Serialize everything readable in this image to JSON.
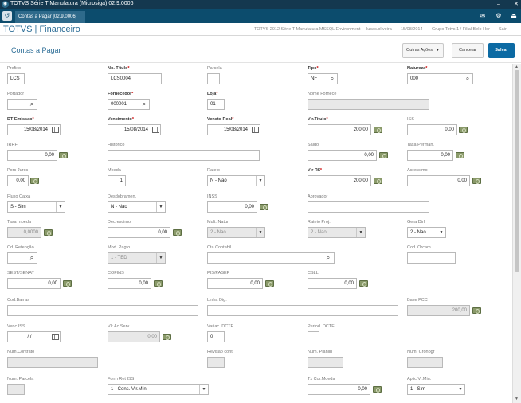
{
  "app": {
    "window_title": "TOTVS Série T Manufatura (Microsiga) 02.9.0006",
    "tab_label": "Contas a Pagar [02.9.0006]",
    "brand": "TOTVS | Financeiro",
    "env": "TOTVS 2012 Série T Manufatura MSSQL Environment",
    "user": "lucas.oliveira",
    "date": "15/08/2014",
    "company": "Grupo Totvs 1 / Filial Belo Hor",
    "logout": "Sair"
  },
  "page": {
    "title": "Contas a Pagar",
    "other_actions": "Outras Ações",
    "cancel": "Cancelar",
    "save": "Salvar"
  },
  "fields": {
    "prefixo": {
      "label": "Prefixo",
      "value": "LCS"
    },
    "no_titulo": {
      "label": "No. Título",
      "value": "LCS0004"
    },
    "parcela": {
      "label": "Parcela",
      "value": ""
    },
    "tipo": {
      "label": "Tipo",
      "value": "NF"
    },
    "natureza": {
      "label": "Natureza",
      "value": "000"
    },
    "portador": {
      "label": "Portador",
      "value": ""
    },
    "fornecedor": {
      "label": "Fornecedor",
      "value": "000001"
    },
    "loja": {
      "label": "Loja",
      "value": "01"
    },
    "nome_fornece": {
      "label": "Nome Fornece",
      "value": ""
    },
    "dt_emissao": {
      "label": "DT Emissao",
      "value": "15/08/2014"
    },
    "vencimento": {
      "label": "Vencimento",
      "value": "15/08/2014"
    },
    "vencto_real": {
      "label": "Vencto Real",
      "value": "15/08/2014"
    },
    "vlr_titulo": {
      "label": "Vlr.Titulo",
      "value": "200,00"
    },
    "iss": {
      "label": "ISS",
      "value": "0,00"
    },
    "irrf": {
      "label": "IRRF",
      "value": "0,00"
    },
    "historico": {
      "label": "Historico",
      "value": ""
    },
    "saldo": {
      "label": "Saldo",
      "value": "0,00"
    },
    "taxa_perman": {
      "label": "Taxa Perman.",
      "value": "0,00"
    },
    "porc_juros": {
      "label": "Porc Juros",
      "value": "0,00"
    },
    "moeda": {
      "label": "Moeda",
      "value": "1"
    },
    "rateio": {
      "label": "Rateio",
      "value": "N - Nao"
    },
    "vlr_rs": {
      "label": "Vlr R$",
      "value": "200,00"
    },
    "acrescimo": {
      "label": "Acrescimo",
      "value": "0,00"
    },
    "fluxo_caixa": {
      "label": "Fluxo Caixa",
      "value": "S - Sim"
    },
    "desdobramen": {
      "label": "Desdobramen.",
      "value": "N - Nao"
    },
    "inss": {
      "label": "INSS",
      "value": "0,00"
    },
    "aprovador": {
      "label": "Aprovador",
      "value": ""
    },
    "taxa_moeda": {
      "label": "Taxa moeda",
      "value": "0,0000"
    },
    "decrescimo": {
      "label": "Decrescimo",
      "value": "0,00"
    },
    "mult_natur": {
      "label": "Mult. Natur",
      "value": "2 - Nao"
    },
    "rateio_proj": {
      "label": "Rateio Proj.",
      "value": "2 - Nao"
    },
    "gera_dirf": {
      "label": "Gera Dirf",
      "value": "2 - Nao"
    },
    "cd_retencao": {
      "label": "Cd. Retenção",
      "value": ""
    },
    "mod_pagto": {
      "label": "Mod. Pagto.",
      "value": "1 - TED"
    },
    "cta_contabil": {
      "label": "Cta.Contabil",
      "value": ""
    },
    "cod_orcam": {
      "label": "Cod. Orcam.",
      "value": ""
    },
    "sest_senat": {
      "label": "SEST/SENAT",
      "value": "0,00"
    },
    "cofins": {
      "label": "COFINS",
      "value": "0,00"
    },
    "pis_pasep": {
      "label": "PIS/PASEP",
      "value": "0,00"
    },
    "csll": {
      "label": "CSLL",
      "value": "0,00"
    },
    "cod_barras": {
      "label": "Cod.Barras",
      "value": ""
    },
    "linha_dig": {
      "label": "Linha Dig.",
      "value": ""
    },
    "base_pcc": {
      "label": "Base PCC",
      "value": "200,00"
    },
    "venc_iss": {
      "label": "Venc ISS",
      "value": "/ /"
    },
    "vlr_ac_serv": {
      "label": "Vlr.Ac.Serv.",
      "value": "0,00"
    },
    "variac_dctf": {
      "label": "Variac. DCTF",
      "value": "0"
    },
    "period_dctf": {
      "label": "Period. DCTF",
      "value": ""
    },
    "num_contrato": {
      "label": "Num.Contrato",
      "value": ""
    },
    "revisao_cont": {
      "label": "Revisão cont.",
      "value": ""
    },
    "num_planilh": {
      "label": "Num. Planilh",
      "value": ""
    },
    "num_cronogr": {
      "label": "Num. Cronogr",
      "value": ""
    },
    "num_parcela": {
      "label": "Num. Parcela",
      "value": ""
    },
    "form_ret_iss": {
      "label": "Form Ret ISS",
      "value": "1 - Cons. Vlr.Mín."
    },
    "tx_cor_moeda": {
      "label": "Tx Cor.Moeda",
      "value": "0,00"
    },
    "aplic_vl_min": {
      "label": "Aplic.Vl.Min.",
      "value": "1 - Sim"
    }
  },
  "icons": {
    "search": "search-icon",
    "calendar": "calendar-icon",
    "money": "money-icon",
    "dropdown": "chevron-down-icon"
  },
  "colors": {
    "title_bar": "#14384f",
    "tab_bar": "#0c4c6d",
    "brand": "#2c6d96",
    "primary_button": "#0c6aa3",
    "required_star": "#cc0000"
  }
}
